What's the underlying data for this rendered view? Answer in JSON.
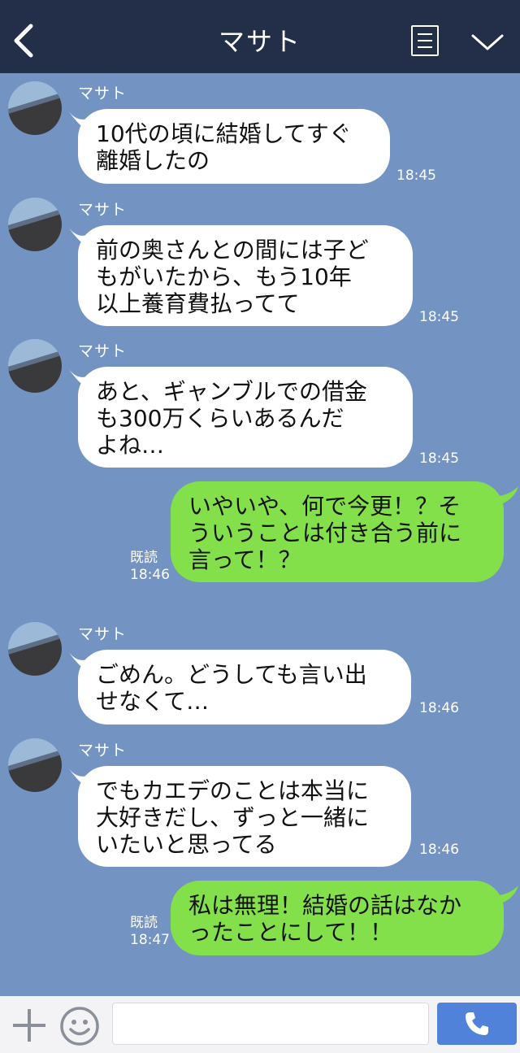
{
  "header": {
    "title": "マサト"
  },
  "messages": [
    {
      "type": "in",
      "sender": "マサト",
      "text": "10代の頃に結婚してすぐ\n離婚したの",
      "time": "18:45"
    },
    {
      "type": "in",
      "sender": "マサト",
      "text": "前の奥さんとの間には子ど\nもがいたから、もう10年\n以上養育費払ってて",
      "time": "18:45"
    },
    {
      "type": "in",
      "sender": "マサト",
      "text": "あと、ギャンブルでの借金\nも300万くらいあるんだ\nよね…",
      "time": "18:45"
    },
    {
      "type": "out",
      "read": "既読",
      "text": "いやいや、何で今更！？そ\nういうことは付き合う前に\n言って！？",
      "time": "18:46"
    },
    {
      "type": "in",
      "sender": "マサト",
      "text": "ごめん。どうしても言い出\nせなくて…",
      "time": "18:46"
    },
    {
      "type": "in",
      "sender": "マサト",
      "text": "でもカエデのことは本当に\n大好きだし、ずっと一緒に\nいたいと思ってる",
      "time": "18:46"
    },
    {
      "type": "out",
      "read": "既読",
      "text": "私は無理！結婚の話はなか\nったことにして！！",
      "time": "18:47"
    }
  ],
  "colors": {
    "header": "#232e48",
    "background": "#7394c3",
    "outgoing": "#84e04a",
    "incoming": "#ffffff",
    "call_button": "#4f82d8"
  },
  "icons": {
    "back": "chevron-left-icon",
    "menu": "list-icon",
    "collapse": "chevron-down-icon",
    "add": "plus-icon",
    "sticker": "smiley-icon",
    "call": "phone-icon"
  }
}
